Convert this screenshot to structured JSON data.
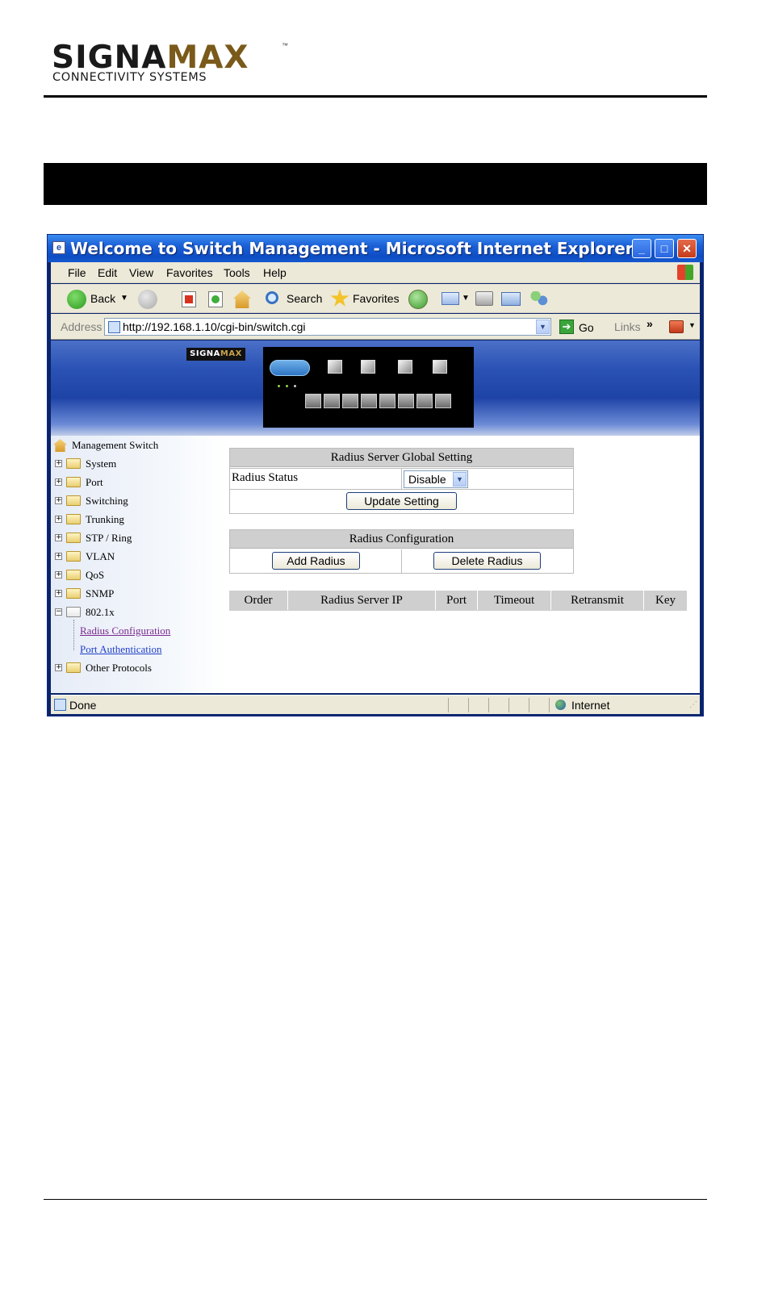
{
  "document": {
    "logo_main_a": "SIGNA",
    "logo_main_b": "MAX",
    "logo_tm": "™",
    "logo_sub": "CONNECTIVITY SYSTEMS"
  },
  "window": {
    "title": "Welcome to Switch Management - Microsoft Internet Explorer",
    "minimize": "_",
    "maximize": "□",
    "close": "✕"
  },
  "menu": {
    "file": "File",
    "edit": "Edit",
    "view": "View",
    "favorites": "Favorites",
    "tools": "Tools",
    "help": "Help"
  },
  "toolbar": {
    "back": "Back",
    "search": "Search",
    "favorites": "Favorites"
  },
  "address": {
    "label": "Address",
    "url": "http://192.168.1.10/cgi-bin/switch.cgi",
    "go": "Go",
    "links": "Links",
    "chevron": "»"
  },
  "banner": {
    "logo_a": "SIGNA",
    "logo_b": "MAX"
  },
  "sidebar": {
    "root": "Management Switch",
    "items": [
      {
        "label": "System",
        "expander": "+"
      },
      {
        "label": "Port",
        "expander": "+"
      },
      {
        "label": "Switching",
        "expander": "+"
      },
      {
        "label": "Trunking",
        "expander": "+"
      },
      {
        "label": "STP / Ring",
        "expander": "+"
      },
      {
        "label": "VLAN",
        "expander": "+"
      },
      {
        "label": "QoS",
        "expander": "+"
      },
      {
        "label": "SNMP",
        "expander": "+"
      },
      {
        "label": "802.1x",
        "expander": "−"
      }
    ],
    "subitems": [
      "Radius Configuration",
      "Port Authentication"
    ],
    "last_item": {
      "label": "Other Protocols",
      "expander": "+"
    }
  },
  "global_setting": {
    "header": "Radius Server Global Setting",
    "status_label": "Radius Status",
    "status_value": "Disable",
    "update_button": "Update Setting"
  },
  "radius_config": {
    "header": "Radius Configuration",
    "add_button": "Add Radius",
    "delete_button": "Delete Radius"
  },
  "radius_table": {
    "columns": [
      "Order",
      "Radius Server IP",
      "Port",
      "Timeout",
      "Retransmit",
      "Key"
    ]
  },
  "status": {
    "text": "Done",
    "zone": "Internet"
  }
}
